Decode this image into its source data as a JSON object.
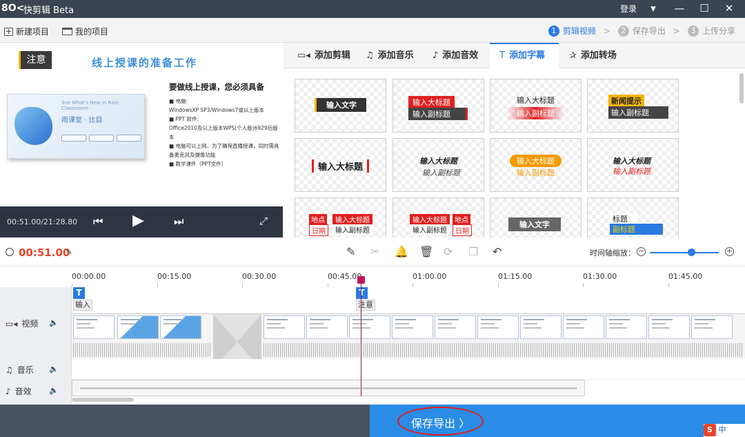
{
  "titlebar": {
    "logo": "8O<",
    "app_name": "快剪辑 Beta",
    "login": "登录",
    "min": "—",
    "max": "☐",
    "close": "✕",
    "menu": "▾"
  },
  "menubar": {
    "new_project": "新建项目",
    "my_projects": "我的项目"
  },
  "steps": [
    {
      "num": "1",
      "label": "剪辑视频"
    },
    {
      "num": "2",
      "label": "保存导出"
    },
    {
      "num": "3",
      "label": "上传分享"
    }
  ],
  "preview": {
    "notice": "注意",
    "title": "线上授课的准备工作",
    "mock_small": "See What's New in Rain Classroom!",
    "mock_big": "雨课堂 · 比目",
    "heading": "要做线上授课，您必须具备",
    "items": [
      "■ 电脑:",
      "WindowsXP SP3/Windows7或以上版本",
      "■ PPT 软件:",
      "Office2010及以上版本WPS(个人版)6929后版本",
      "■ 电脑可以上网，为了确保直播授课，同时需具",
      "备麦克风及摄像功能",
      "■ 教学课件（PPT文件）"
    ],
    "time": "00:51.00/21:28.80"
  },
  "tabs": [
    {
      "icon": "▭◂",
      "label": "添加剪辑"
    },
    {
      "icon": "♫",
      "label": "添加音乐"
    },
    {
      "icon": "♪",
      "label": "添加音效"
    },
    {
      "icon": "T",
      "label": "添加字幕"
    },
    {
      "icon": "✰",
      "label": "添加转场"
    }
  ],
  "subtitle_templates": {
    "c1": "输入文字",
    "c2a": "输入大标题",
    "c2b": "输入副标题",
    "c3a": "输入大标题",
    "c3b": "输入副标题",
    "c4a": "新闻提示",
    "c4b": "输入副标题",
    "c5": "输入大标题",
    "c6a": "输入大标题",
    "c6b": "输入副标题",
    "c7a": "输入大标题",
    "c7b": "输入副标题",
    "c8a": "输入大标题",
    "c8b": "输入副标题",
    "c9a": "地点",
    "c9b": "输入大标题",
    "c9c": "日期",
    "c9d": "输入副标题",
    "c10a": "输入大标题",
    "c10b": "地点",
    "c10c": "输入副标题",
    "c10d": "日期",
    "c11": "输入文字",
    "c12a": "标题",
    "c12b": "副标题"
  },
  "editbar": {
    "current_time": "00:51.00",
    "zoom_label": "时间轴缩放："
  },
  "ruler": [
    "00:00.00",
    "00:15.00",
    "00:30.00",
    "00:45.00",
    "01:00.00",
    "01:15.00",
    "01:30.00",
    "01:45.00"
  ],
  "tracks": {
    "video": "视频",
    "music": "音乐",
    "sfx": "音效"
  },
  "subtitle_clips": {
    "first": "输入",
    "second": "注意"
  },
  "export": {
    "label": "保存导出 〉"
  },
  "ime": {
    "s": "S",
    "text": "中"
  }
}
